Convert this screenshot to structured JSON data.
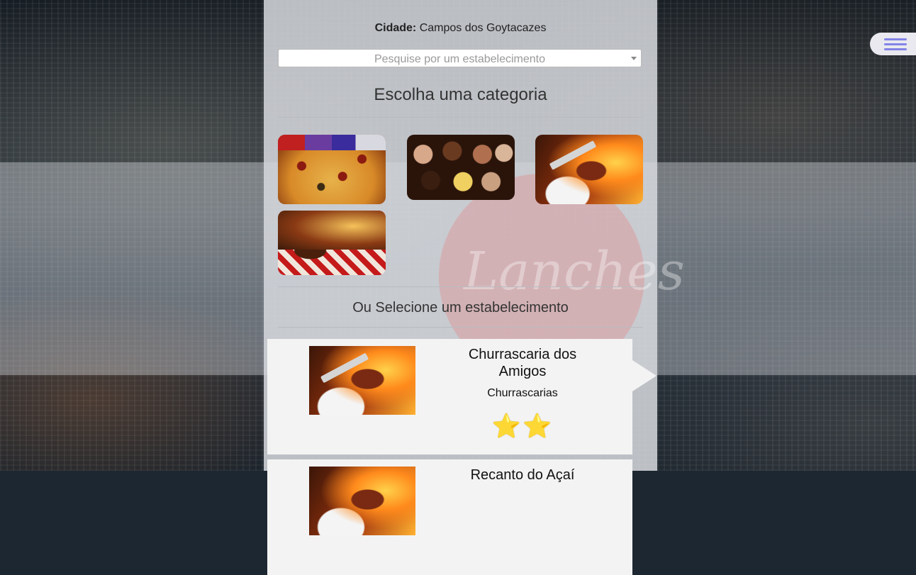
{
  "header": {
    "city_label": "Cidade:",
    "city_value": "Campos dos Goytacazes"
  },
  "search": {
    "placeholder": "Pesquise por um estabelecimento"
  },
  "categories_section": {
    "title": "Escolha uma categoria",
    "items": [
      {
        "image": "pizza"
      },
      {
        "image": "chocolates"
      },
      {
        "image": "churrasco"
      },
      {
        "image": "hamburguer"
      }
    ]
  },
  "establishments_section": {
    "title": "Ou Selecione um estabelecimento",
    "items": [
      {
        "name": "Churrascaria dos Amigos",
        "category": "Churrascarias",
        "rating": 2,
        "stars": "⭐⭐"
      },
      {
        "name": "Recanto do Açaí",
        "category": "",
        "rating": null,
        "stars": ""
      }
    ]
  },
  "background_logo": "Lanches",
  "menu_icon": "hamburger-menu-icon",
  "colors": {
    "menu_icon": "#8383e8",
    "star": "#f1c21b",
    "card_background": "#f3f3f3"
  }
}
